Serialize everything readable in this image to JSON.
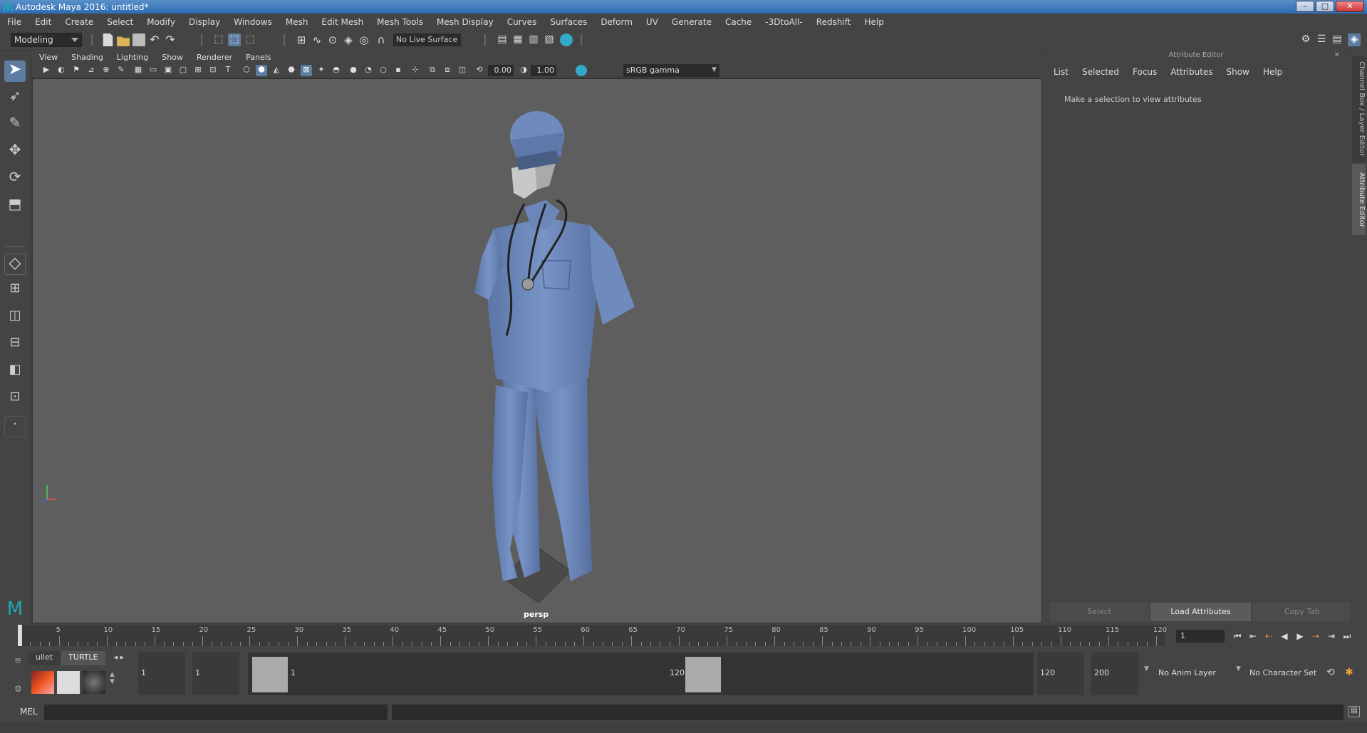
{
  "window": {
    "title": "Autodesk Maya 2016: untitled*"
  },
  "menu": [
    "File",
    "Edit",
    "Create",
    "Select",
    "Modify",
    "Display",
    "Windows",
    "Mesh",
    "Edit Mesh",
    "Mesh Tools",
    "Mesh Display",
    "Curves",
    "Surfaces",
    "Deform",
    "UV",
    "Generate",
    "Cache",
    "-3DtoAll-",
    "Redshift",
    "Help"
  ],
  "toolbar": {
    "mode": "Modeling",
    "live_surface": "No Live Surface"
  },
  "viewport": {
    "menu": [
      "View",
      "Shading",
      "Lighting",
      "Show",
      "Renderer",
      "Panels"
    ],
    "exposure": "0.00",
    "gamma_value": "1.00",
    "color_space": "sRGB gamma",
    "camera": "persp"
  },
  "attribute_editor": {
    "title": "Attribute Editor",
    "tabs": [
      "List",
      "Selected",
      "Focus",
      "Attributes",
      "Show",
      "Help"
    ],
    "message": "Make a selection to view attributes",
    "buttons": [
      "Select",
      "Load Attributes",
      "Copy Tab"
    ]
  },
  "side_tabs": [
    "Channel Box / Layer Editor",
    "Attribute Editor"
  ],
  "timeline": {
    "ticks": [
      "1",
      "5",
      "10",
      "15",
      "20",
      "25",
      "30",
      "35",
      "40",
      "45",
      "50",
      "55",
      "60",
      "65",
      "70",
      "75",
      "80",
      "85",
      "90",
      "95",
      "100",
      "105",
      "110",
      "115",
      "120"
    ],
    "current_frame": "1"
  },
  "shelf": {
    "tabs": [
      "ullet",
      "TURTLE"
    ]
  },
  "range": {
    "start": "1",
    "playback_start": "1",
    "slider_start_label": "1",
    "slider_end_label": "120",
    "playback_end": "120",
    "end": "200",
    "anim_layer": "No Anim Layer",
    "character_set": "No Character Set"
  },
  "command_line": {
    "label": "MEL"
  },
  "colors": {
    "accent": "#5d7da0",
    "scrubs": "#6b86b5",
    "viewport_bg": "#5e5e5e"
  }
}
